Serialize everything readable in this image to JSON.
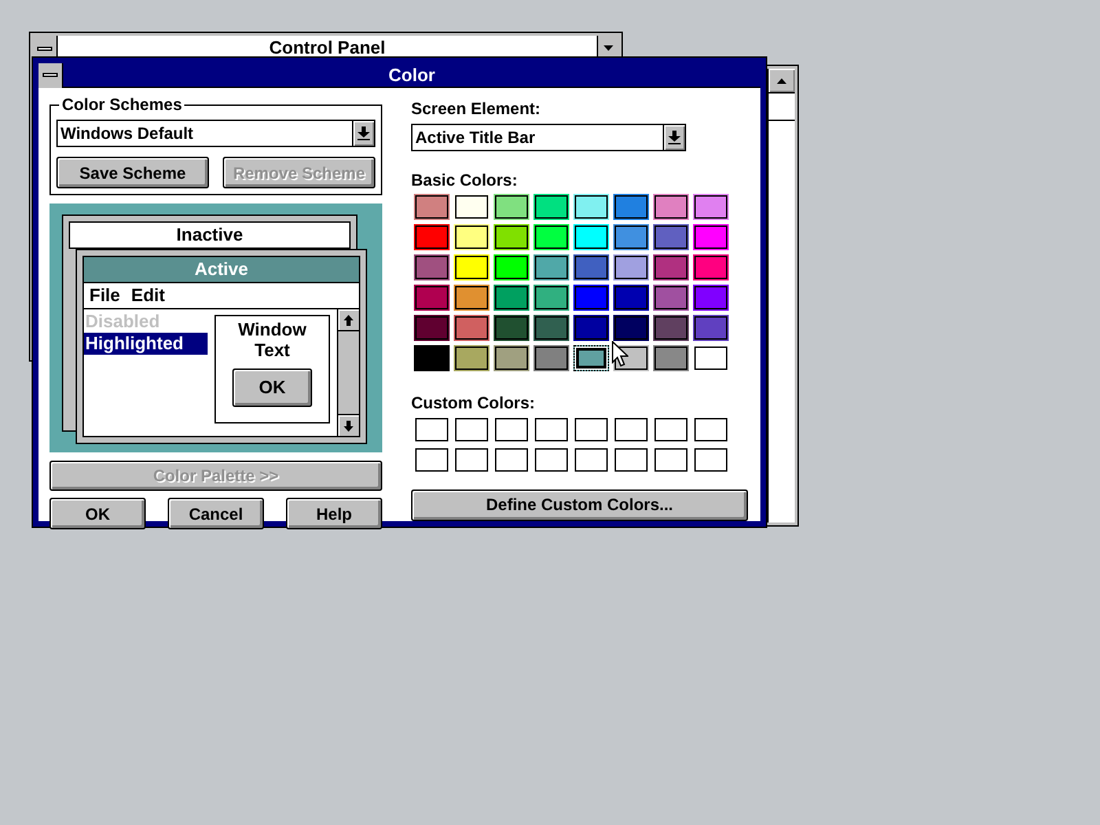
{
  "background_window": {
    "title": "Control Panel"
  },
  "dialog": {
    "title": "Color"
  },
  "color_schemes": {
    "label": "Color Schemes",
    "value": "Windows Default",
    "buttons": [
      {
        "label": "Save Scheme",
        "disabled": false
      },
      {
        "label": "Remove Scheme",
        "disabled": true
      }
    ]
  },
  "preview": {
    "inactive_title": "Inactive",
    "active_title": "Active",
    "menu": [
      "File",
      "Edit"
    ],
    "list": [
      {
        "label": "Disabled",
        "kind": "disabled"
      },
      {
        "label": "Highlighted",
        "kind": "highlighted"
      }
    ],
    "window_text": "Window Text",
    "button": "OK"
  },
  "palette_button": {
    "label": "Color Palette >>",
    "disabled": true
  },
  "buttons": [
    "OK",
    "Cancel",
    "Help"
  ],
  "screen_element": {
    "label": "Screen Element:",
    "value": "Active Title Bar"
  },
  "basic_colors_label": "Basic Colors:",
  "basic_colors": [
    {
      "color": "#d08080",
      "selected": false
    },
    {
      "color": "#fffff0",
      "selected": false
    },
    {
      "color": "#80e080",
      "selected": false
    },
    {
      "color": "#00e080",
      "selected": false
    },
    {
      "color": "#80f0f0",
      "selected": false
    },
    {
      "color": "#2080e0",
      "selected": false
    },
    {
      "color": "#e080c0",
      "selected": false
    },
    {
      "color": "#e080f0",
      "selected": false
    },
    {
      "color": "#ff0000",
      "selected": false
    },
    {
      "color": "#ffff80",
      "selected": false
    },
    {
      "color": "#80e000",
      "selected": false
    },
    {
      "color": "#00ff40",
      "selected": false
    },
    {
      "color": "#00ffff",
      "selected": false
    },
    {
      "color": "#4090e0",
      "selected": false
    },
    {
      "color": "#6060c0",
      "selected": false
    },
    {
      "color": "#ff00ff",
      "selected": false
    },
    {
      "color": "#a05080",
      "selected": false
    },
    {
      "color": "#ffff00",
      "selected": false
    },
    {
      "color": "#00ff00",
      "selected": false
    },
    {
      "color": "#50a8a8",
      "selected": false
    },
    {
      "color": "#4060c0",
      "selected": false
    },
    {
      "color": "#a0a0e0",
      "selected": false
    },
    {
      "color": "#b03080",
      "selected": false
    },
    {
      "color": "#ff0080",
      "selected": false
    },
    {
      "color": "#b00050",
      "selected": false
    },
    {
      "color": "#e09030",
      "selected": false
    },
    {
      "color": "#00a060",
      "selected": false
    },
    {
      "color": "#30b080",
      "selected": false
    },
    {
      "color": "#0000ff",
      "selected": false
    },
    {
      "color": "#0000b0",
      "selected": false
    },
    {
      "color": "#a050a0",
      "selected": false
    },
    {
      "color": "#8000ff",
      "selected": false
    },
    {
      "color": "#600030",
      "selected": false
    },
    {
      "color": "#d06060",
      "selected": false
    },
    {
      "color": "#205030",
      "selected": false
    },
    {
      "color": "#306050",
      "selected": false
    },
    {
      "color": "#0000a0",
      "selected": false
    },
    {
      "color": "#000060",
      "selected": false
    },
    {
      "color": "#604060",
      "selected": false
    },
    {
      "color": "#6040c0",
      "selected": false
    },
    {
      "color": "#000000",
      "selected": false
    },
    {
      "color": "#a8a860",
      "selected": false
    },
    {
      "color": "#a0a080",
      "selected": false
    },
    {
      "color": "#808080",
      "selected": false
    },
    {
      "color": "#60a0a0",
      "selected": true
    },
    {
      "color": "#c0c0c0",
      "selected": false
    },
    {
      "color": "#888888",
      "selected": false
    },
    {
      "color": "#ffffff",
      "selected": false
    }
  ],
  "custom_colors_label": "Custom Colors:",
  "custom_colors": [
    {
      "color": "#ffffff"
    },
    {
      "color": "#ffffff"
    },
    {
      "color": "#ffffff"
    },
    {
      "color": "#ffffff"
    },
    {
      "color": "#ffffff"
    },
    {
      "color": "#ffffff"
    },
    {
      "color": "#ffffff"
    },
    {
      "color": "#ffffff"
    },
    {
      "color": "#ffffff"
    },
    {
      "color": "#ffffff"
    },
    {
      "color": "#ffffff"
    },
    {
      "color": "#ffffff"
    },
    {
      "color": "#ffffff"
    },
    {
      "color": "#ffffff"
    },
    {
      "color": "#ffffff"
    },
    {
      "color": "#ffffff"
    }
  ],
  "define_button": "Define Custom Colors..."
}
